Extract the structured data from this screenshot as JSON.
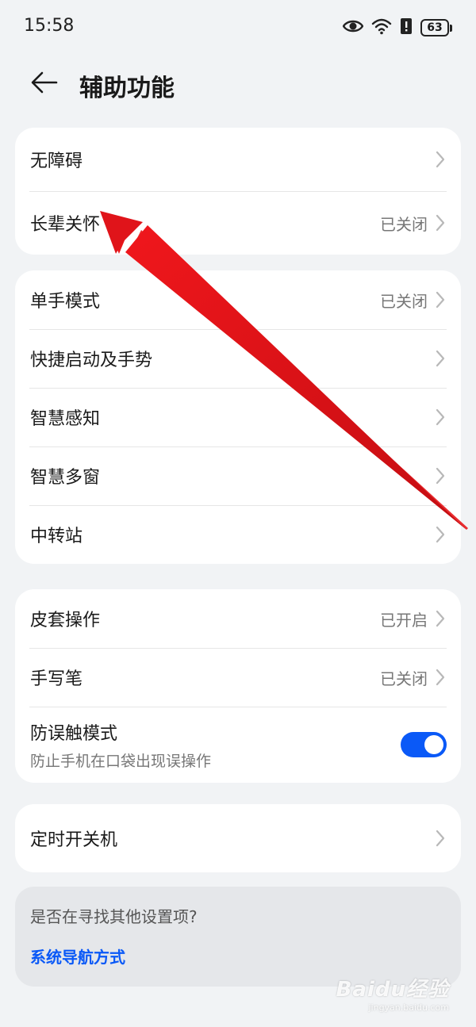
{
  "status_bar": {
    "time": "15:58",
    "battery": "63",
    "icons": [
      "eye-icon",
      "wifi-icon",
      "alert-icon",
      "battery-icon"
    ]
  },
  "header": {
    "title": "辅助功能",
    "back_icon": "back-arrow-icon"
  },
  "group1": [
    {
      "label": "无障碍",
      "value": ""
    },
    {
      "label": "长辈关怀",
      "value": "已关闭"
    }
  ],
  "group2": [
    {
      "label": "单手模式",
      "value": "已关闭"
    },
    {
      "label": "快捷启动及手势",
      "value": ""
    },
    {
      "label": "智慧感知",
      "value": ""
    },
    {
      "label": "智慧多窗",
      "value": ""
    },
    {
      "label": "中转站",
      "value": ""
    }
  ],
  "group3": {
    "case_op": {
      "label": "皮套操作",
      "value": "已开启"
    },
    "stylus": {
      "label": "手写笔",
      "value": "已关闭"
    },
    "anti_touch": {
      "label": "防误触模式",
      "subtitle": "防止手机在口袋出现误操作",
      "enabled": true
    }
  },
  "group4": [
    {
      "label": "定时开关机",
      "value": ""
    }
  ],
  "hint": {
    "title": "是否在寻找其他设置项?",
    "link": "系统导航方式"
  },
  "watermark": {
    "main": "Baidu经验",
    "sub": "jingyan.baidu.com"
  },
  "colors": {
    "accent": "#0a59f7",
    "annotation_arrow": "#e8161a",
    "background": "#f1f3f5"
  }
}
